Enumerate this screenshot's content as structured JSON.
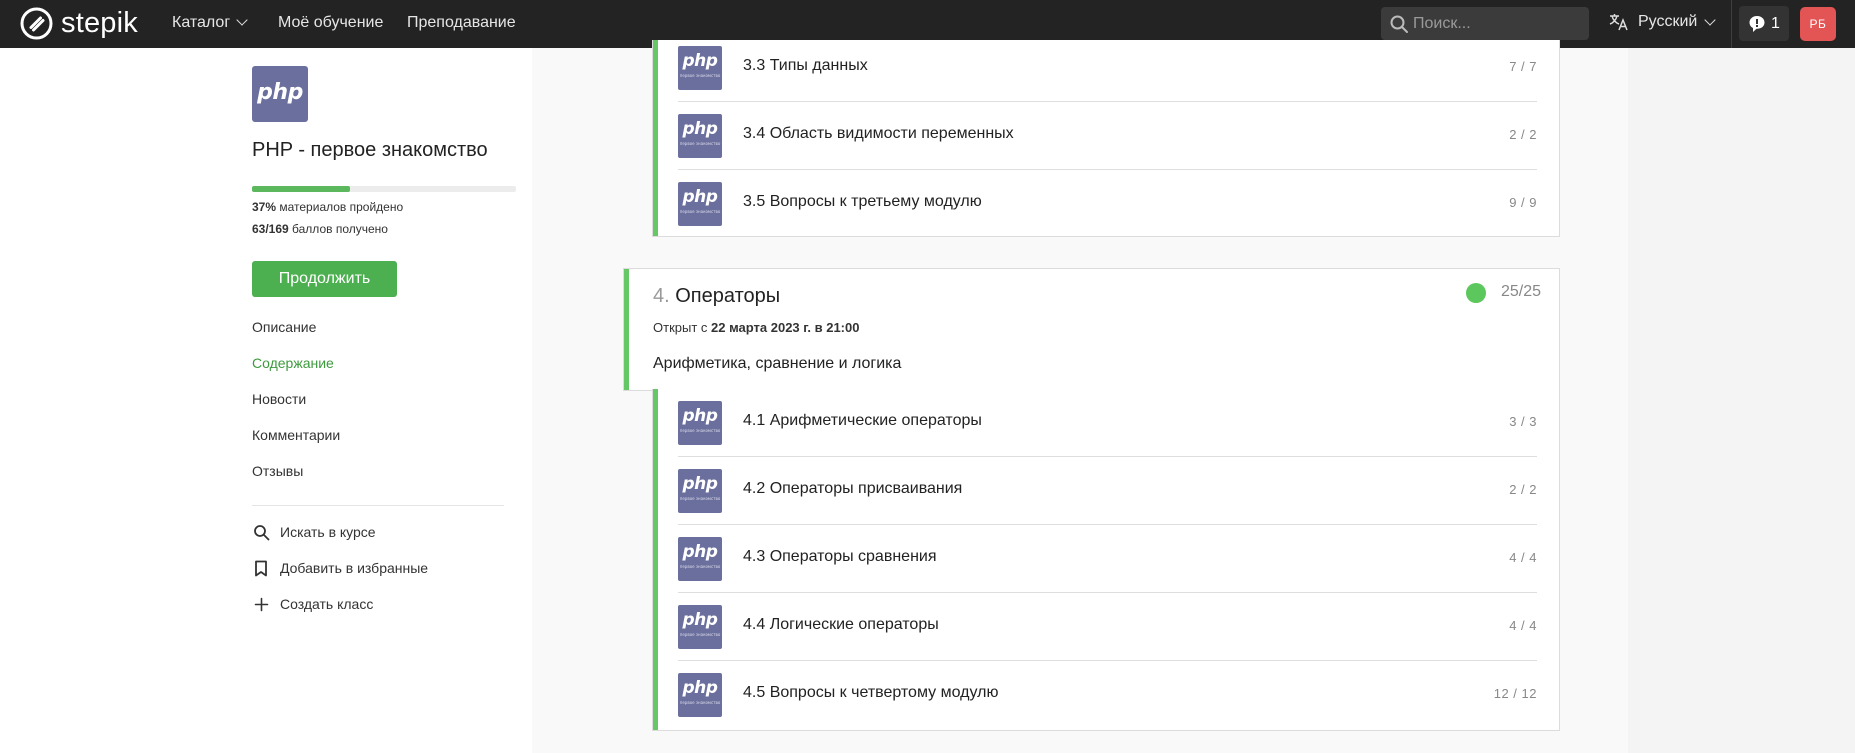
{
  "header": {
    "logo_text": "stepik",
    "nav": [
      {
        "label": "Каталог",
        "has_dropdown": true
      },
      {
        "label": "Моё обучение",
        "has_dropdown": false
      },
      {
        "label": "Преподавание",
        "has_dropdown": false
      }
    ],
    "search_placeholder": "Поиск...",
    "language": "Русский",
    "notifications_count": "1",
    "avatar_initials": "РБ",
    "avatar_color": "#e35454"
  },
  "sidebar": {
    "course_logo_text": "php",
    "course_title": "PHP - первое знакомство",
    "progress_fraction": 0.37,
    "materials_value": "37%",
    "materials_label": " материалов пройдено",
    "points_value": "63/169",
    "points_label": " баллов получено",
    "continue_label": "Продолжить",
    "links": [
      {
        "label": "Описание",
        "active": false
      },
      {
        "label": "Содержание",
        "active": true
      },
      {
        "label": "Новости",
        "active": false
      },
      {
        "label": "Комментарии",
        "active": false
      },
      {
        "label": "Отзывы",
        "active": false
      }
    ],
    "actions": [
      {
        "label": "Искать в курсе",
        "icon": "search-icon"
      },
      {
        "label": "Добавить в избранные",
        "icon": "bookmark-icon"
      },
      {
        "label": "Создать класс",
        "icon": "plus-icon"
      }
    ]
  },
  "badge": {
    "text": "php",
    "subtext": "первое знакомство",
    "color": "#6b6f9d"
  },
  "module3": {
    "lessons": [
      {
        "title": "3.3 Типы данных",
        "score": "7 / 7"
      },
      {
        "title": "3.4 Область видимости переменных",
        "score": "2 / 2"
      },
      {
        "title": "3.5 Вопросы к третьему модулю",
        "score": "9 / 9"
      }
    ]
  },
  "module4": {
    "number": "4.",
    "title": "Операторы",
    "score": "25/25",
    "open_prefix": "Открыт с ",
    "open_date": "22 марта 2023 г. в 21:00",
    "description": "Арифметика, сравнение и логика",
    "lessons": [
      {
        "title": "4.1 Арифметические операторы",
        "score": "3 / 3"
      },
      {
        "title": "4.2 Операторы присваивания",
        "score": "2 / 2"
      },
      {
        "title": "4.3 Операторы сравнения",
        "score": "4 / 4"
      },
      {
        "title": "4.4 Логические операторы",
        "score": "4 / 4"
      },
      {
        "title": "4.5 Вопросы к четвертому модулю",
        "score": "12 / 12"
      }
    ]
  }
}
